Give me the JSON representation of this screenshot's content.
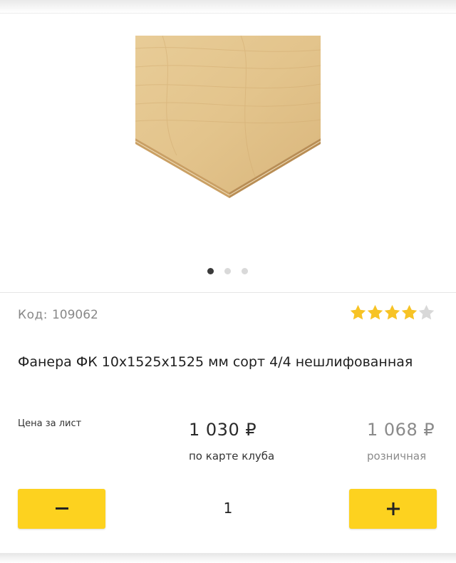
{
  "product": {
    "code_label": "Код:",
    "code_value": "109062",
    "rating": 4,
    "rating_max": 5,
    "title": "Фанера ФК 10х1525х1525 мм сорт 4/4 нешлифованная",
    "image_icon": "plywood-sheet-image"
  },
  "carousel": {
    "count": 3,
    "active": 0
  },
  "price": {
    "label": "Цена за лист",
    "club_price": "1 030 ₽",
    "club_caption": "по карте клуба",
    "retail_price": "1 068 ₽",
    "retail_caption": "розничная"
  },
  "quantity": {
    "value": "1",
    "minus_icon": "minus-icon",
    "plus_icon": "plus-icon"
  },
  "colors": {
    "accent": "#fdd21f",
    "star_filled": "#f7c325",
    "star_empty": "#d8d8d8"
  }
}
